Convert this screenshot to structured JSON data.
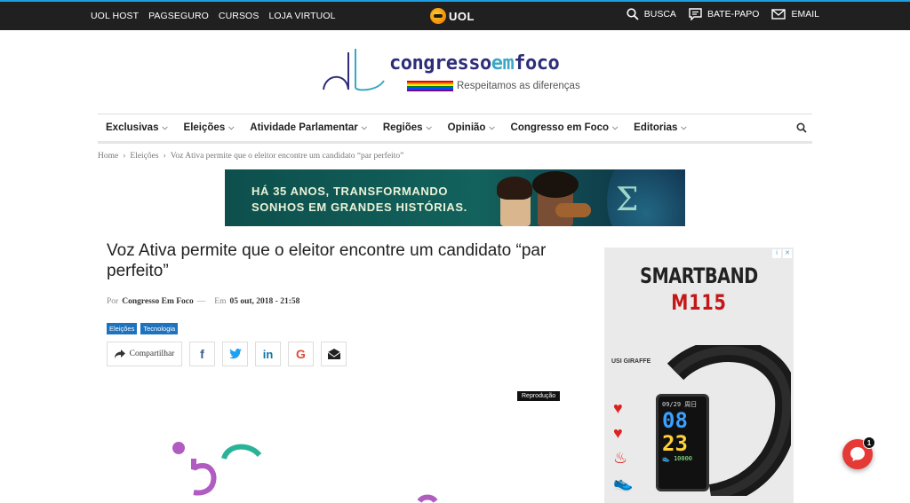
{
  "topbar": {
    "links": [
      "UOL HOST",
      "PAGSEGURO",
      "CURSOS",
      "LOJA VIRTUOL"
    ],
    "logo_text": "UOL",
    "busca": "BUSCA",
    "batepapo": "BATE-PAPO",
    "email": "EMAIL"
  },
  "brand": {
    "name_a": "congresso",
    "name_b": "em",
    "name_c": "foco",
    "tagline": "Respeitamos as diferenças"
  },
  "nav": {
    "items": [
      "Exclusivas",
      "Eleições",
      "Atividade Parlamentar",
      "Regiões",
      "Opinião",
      "Congresso em Foco",
      "Editorias"
    ]
  },
  "breadcrumb": {
    "home": "Home",
    "section": "Eleições",
    "current": "Voz Ativa permite que o eleitor encontre um candidato “par perfeito”"
  },
  "banner": {
    "line1": "HÁ 35 ANOS, TRANSFORMANDO",
    "line2": "SONHOS EM GRANDES HISTÓRIAS.",
    "sigma": "Σ"
  },
  "article": {
    "title": "Voz Ativa permite que o eleitor encontre um candidato “par perfeito”",
    "by_label": "Por",
    "author": "Congresso Em Foco",
    "dash": "—",
    "on_label": "Em",
    "date": "05 out, 2018 - 21:58",
    "tags": [
      "Eleições",
      "Tecnologia"
    ],
    "share_label": "Compartilhar",
    "photo_credit": "Reprodução"
  },
  "ad": {
    "headline": "SMARTBAND",
    "model": "M115",
    "brand": "USI GIRAFFE",
    "screen_date": "09/29",
    "screen_day": "周日",
    "time_h": "08",
    "time_m": "23",
    "steps": "10000"
  },
  "chat": {
    "count": "1"
  },
  "colors": {
    "accent": "#1e73be",
    "topbar": "#202020",
    "chat": "#e53935"
  }
}
